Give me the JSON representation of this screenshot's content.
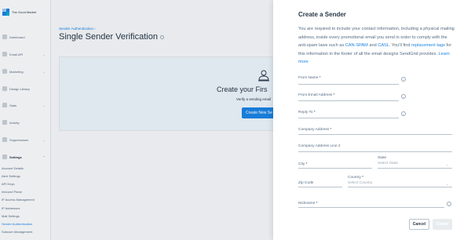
{
  "app": {
    "logo_text": "The Good Market"
  },
  "sidebar": {
    "items": [
      {
        "label": "Dashboard",
        "icon": "dashboard-icon"
      },
      {
        "label": "Email API",
        "icon": "email-api-icon"
      },
      {
        "label": "Marketing",
        "icon": "marketing-icon"
      },
      {
        "label": "Design Library",
        "icon": "design-library-icon"
      },
      {
        "label": "Stats",
        "icon": "stats-icon"
      },
      {
        "label": "Activity",
        "icon": "activity-icon"
      },
      {
        "label": "Suppressions",
        "icon": "suppressions-icon"
      },
      {
        "label": "Settings",
        "icon": "settings-icon"
      }
    ],
    "settings_sub": [
      "Account Details",
      "Alert Settings",
      "API Keys",
      "Inbound Parse",
      "IP Access Management",
      "IP Addresses",
      "Mail Settings",
      "Sender Authentication",
      "Subuser Management"
    ]
  },
  "main": {
    "breadcrumb": "Sender Authentication",
    "title": "Single Sender Verification",
    "empty_title": "Create your Firs",
    "empty_sub": "Verify a sending email",
    "create_new_label": "Create New Se"
  },
  "drawer": {
    "title": "Create a Sender",
    "desc_1": "You are required to include your contact information, including a physical mailing address, inside every promotional email you send in order to comply with the anti-spam laws such as ",
    "link_canspam": "CAN-SPAM",
    "desc_and": " and ",
    "link_casl": "CASL",
    "desc_2": ". You'll find ",
    "link_replacement": "replacement tags",
    "desc_3": " for this information in the footer of all the email designs SendGrid provides. ",
    "link_learn": "Learn more",
    "fields": {
      "from_name": "From Name",
      "from_email": "From Email Address",
      "reply_to": "Reply To",
      "company_address": "Company Address",
      "company_address_2": "Company Address Line 2",
      "city": "City",
      "state": "State",
      "state_placeholder": "Select State",
      "zip": "Zip Code",
      "country": "Country",
      "country_placeholder": "Select Country",
      "nickname": "Nickname"
    },
    "required_mark": "*",
    "info_glyph": "i",
    "cancel_label": "Cancel",
    "create_label": "Create"
  },
  "colors": {
    "accent": "#1a82e2",
    "text": "#263746",
    "muted": "#546b81"
  }
}
